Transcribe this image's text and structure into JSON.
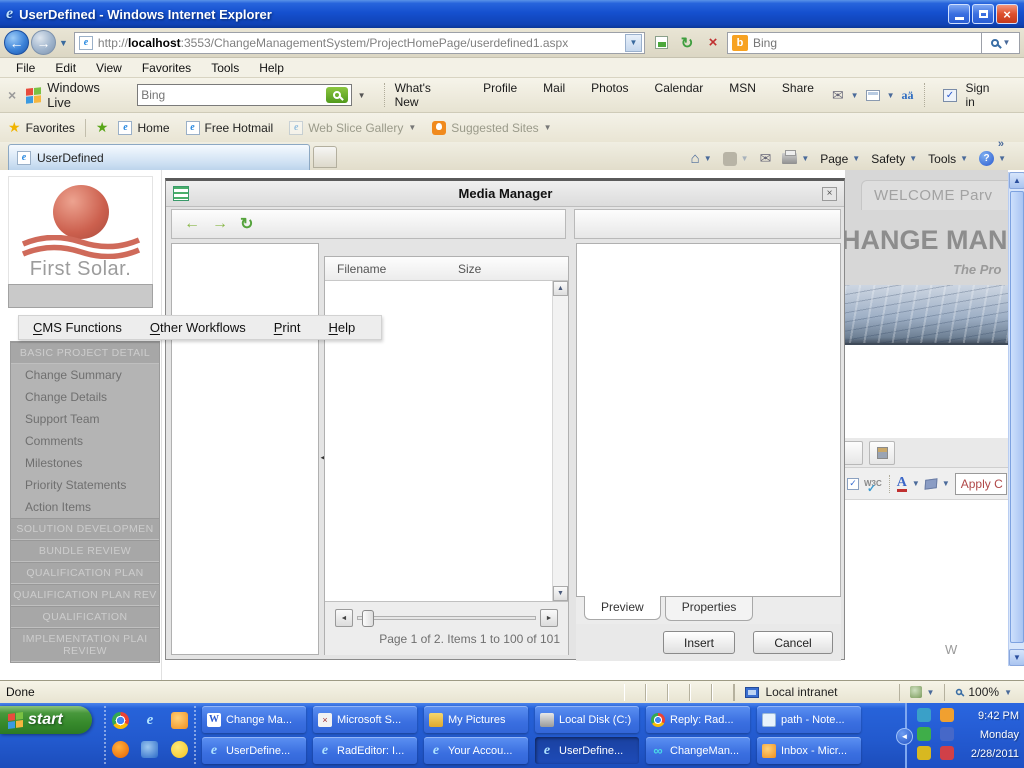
{
  "window": {
    "title": "UserDefined - Windows Internet Explorer"
  },
  "address_bar": {
    "protocol": "http://",
    "host": "localhost",
    "path": ":3553/ChangeManagementSystem/ProjectHomePage/userdefined1.aspx",
    "search_placeholder": "Bing"
  },
  "menu_bar": {
    "items": [
      "File",
      "Edit",
      "View",
      "Favorites",
      "Tools",
      "Help"
    ]
  },
  "live_bar": {
    "brand": "Windows Live",
    "search_placeholder": "Bing",
    "links": [
      "What's New",
      "Profile",
      "Mail",
      "Photos",
      "Calendar",
      "MSN",
      "Share"
    ],
    "sign_in": "Sign in"
  },
  "favorites_bar": {
    "label": "Favorites",
    "items": [
      {
        "label": "Home",
        "icon": "ie-page",
        "muted": false,
        "caret": false
      },
      {
        "label": "Free Hotmail",
        "icon": "ie-page",
        "muted": false,
        "caret": false
      },
      {
        "label": "Web Slice Gallery",
        "icon": "ie-page-muted",
        "muted": true,
        "caret": true
      },
      {
        "label": "Suggested Sites",
        "icon": "bulb",
        "muted": true,
        "caret": true
      }
    ]
  },
  "tab_bar": {
    "active_tab": "UserDefined",
    "overflow_chevron": "»"
  },
  "command_bar": {
    "page": "Page",
    "safety": "Safety",
    "tools": "Tools"
  },
  "app_menu": {
    "items": [
      "CMS Functions",
      "Other Workflows",
      "Print",
      "Help"
    ]
  },
  "sidebar": {
    "logo_text": "First Solar.",
    "menu": [
      {
        "type": "header",
        "label": "BASIC PROJECT DETAIL"
      },
      {
        "type": "item",
        "label": "Change Summary"
      },
      {
        "type": "item",
        "label": "Change Details"
      },
      {
        "type": "item",
        "label": "Support Team"
      },
      {
        "type": "item",
        "label": "Comments"
      },
      {
        "type": "item",
        "label": "Milestones"
      },
      {
        "type": "item",
        "label": "Priority Statements"
      },
      {
        "type": "item",
        "label": "Action Items"
      },
      {
        "type": "header",
        "label": "SOLUTION DEVELOPMEN"
      },
      {
        "type": "header",
        "label": "BUNDLE REVIEW"
      },
      {
        "type": "header",
        "label": "QUALIFICATION PLAN"
      },
      {
        "type": "header",
        "label": "QUALIFICATION PLAN REV"
      },
      {
        "type": "header",
        "label": "QUALIFICATION"
      },
      {
        "type": "header-tall",
        "label": "IMPLEMENTATION PLAI REVIEW"
      }
    ]
  },
  "media_manager": {
    "title": "Media Manager",
    "columns": {
      "filename": "Filename",
      "size": "Size"
    },
    "pager_text": "Page 1 of 2. Items 1 to 100 of 101",
    "tabs": {
      "preview": "Preview",
      "properties": "Properties"
    },
    "buttons": {
      "insert": "Insert",
      "cancel": "Cancel"
    }
  },
  "page": {
    "welcome": "WELCOME Parv",
    "heading": "HANGE MANAG",
    "tagline": "The Pro",
    "partial_text": "W",
    "editor": {
      "w3c": "W3C",
      "font_letter": "A",
      "apply_dropdown": "Apply C"
    }
  },
  "status_bar": {
    "status": "Done",
    "zone": "Local intranet",
    "zoom": "100%"
  },
  "taskbar": {
    "start_label": "start",
    "quick_launch": [
      {
        "name": "chrome-icon",
        "style": "chrome"
      },
      {
        "name": "internet-explorer-icon",
        "style": "ie",
        "glyph": "e"
      },
      {
        "name": "outlook-icon",
        "style": "clock"
      },
      {
        "name": "firefox-icon",
        "style": "firefox"
      },
      {
        "name": "messenger-icon",
        "style": "blue"
      },
      {
        "name": "smiley-icon",
        "style": "smiley"
      }
    ],
    "tasks_row1": [
      {
        "label": "Change Ma...",
        "icon": "word",
        "glyph": "W"
      },
      {
        "label": "Microsoft S...",
        "icon": "tool",
        "glyph": "×"
      },
      {
        "label": "My Pictures",
        "icon": "pictures"
      },
      {
        "label": "Local Disk (C:)",
        "icon": "disk"
      },
      {
        "label": "Reply: Rad...",
        "icon": "chrome"
      },
      {
        "label": "path - Note...",
        "icon": "notepad"
      }
    ],
    "tasks_row2": [
      {
        "label": "UserDefine...",
        "icon": "ie",
        "glyph": "e"
      },
      {
        "label": "RadEditor: I...",
        "icon": "ie",
        "glyph": "e"
      },
      {
        "label": "Your Accou...",
        "icon": "ie",
        "glyph": "e"
      },
      {
        "label": "UserDefine...",
        "icon": "ie",
        "glyph": "e",
        "active": true
      },
      {
        "label": "ChangeMan...",
        "icon": "infinity",
        "glyph": "∞"
      },
      {
        "label": "Inbox - Micr...",
        "icon": "outlook"
      }
    ],
    "tray": {
      "time": "9:42 PM",
      "day": "Monday",
      "date": "2/28/2011",
      "icons": [
        {
          "name": "messenger-tray-icon",
          "color": "#3aa0c8"
        },
        {
          "name": "reminder-tray-icon",
          "color": "#f0a030"
        },
        {
          "name": "sync-tray-icon",
          "color": "#3fae49"
        },
        {
          "name": "network-tray-icon",
          "color": "#4668c8"
        },
        {
          "name": "lock-tray-icon",
          "color": "#d8b820"
        },
        {
          "name": "alert-tray-icon",
          "color": "#d04048"
        }
      ]
    }
  },
  "colors": {
    "titlebar_blue": "#1550cf",
    "taskbar_blue": "#2763da",
    "start_green": "#378a2c",
    "logo_red": "#c85f4e",
    "apply_text_red": "#b04848"
  }
}
